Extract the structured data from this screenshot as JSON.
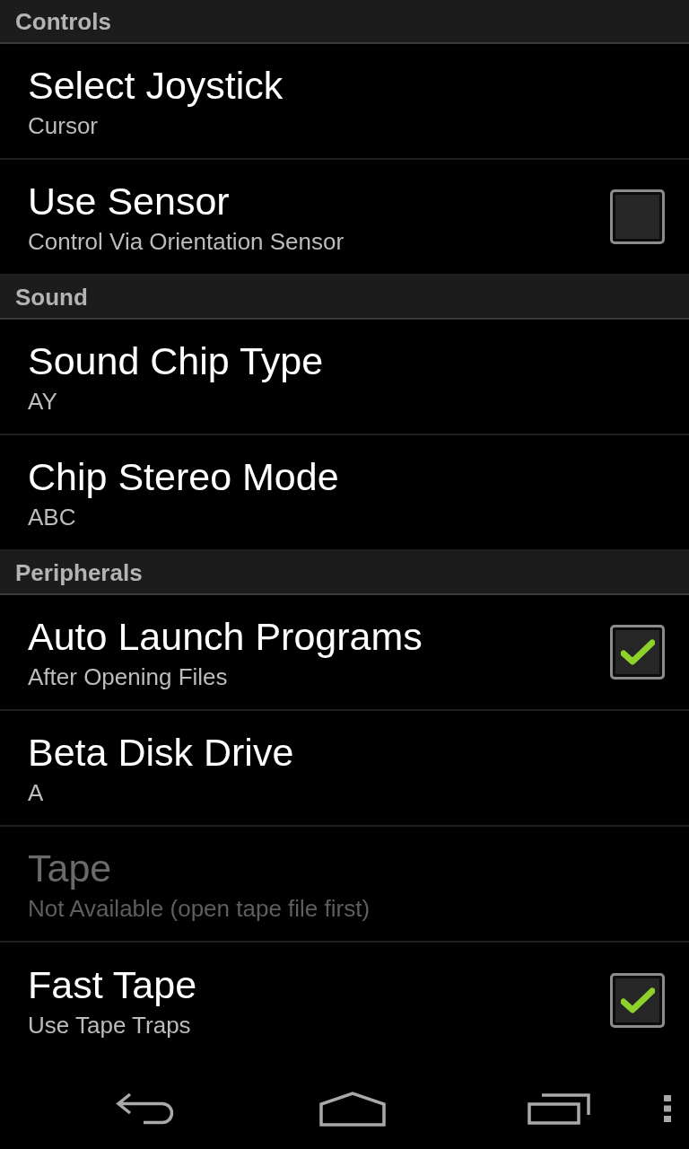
{
  "sections": [
    {
      "title": "Controls",
      "items": [
        {
          "kind": "list",
          "title": "Select Joystick",
          "summary": "Cursor",
          "disabled": false
        },
        {
          "kind": "checkbox",
          "title": "Use Sensor",
          "summary": "Control Via Orientation Sensor",
          "checked": false,
          "disabled": false
        }
      ]
    },
    {
      "title": "Sound",
      "items": [
        {
          "kind": "list",
          "title": "Sound Chip Type",
          "summary": "AY",
          "disabled": false
        },
        {
          "kind": "list",
          "title": "Chip Stereo Mode",
          "summary": "ABC",
          "disabled": false
        }
      ]
    },
    {
      "title": "Peripherals",
      "items": [
        {
          "kind": "checkbox",
          "title": "Auto Launch Programs",
          "summary": "After Opening Files",
          "checked": true,
          "disabled": false
        },
        {
          "kind": "list",
          "title": "Beta Disk Drive",
          "summary": "A",
          "disabled": false
        },
        {
          "kind": "list",
          "title": "Tape",
          "summary": "Not Available (open tape file first)",
          "disabled": true
        },
        {
          "kind": "checkbox",
          "title": "Fast Tape",
          "summary": "Use Tape Traps",
          "checked": true,
          "disabled": false
        }
      ]
    }
  ]
}
